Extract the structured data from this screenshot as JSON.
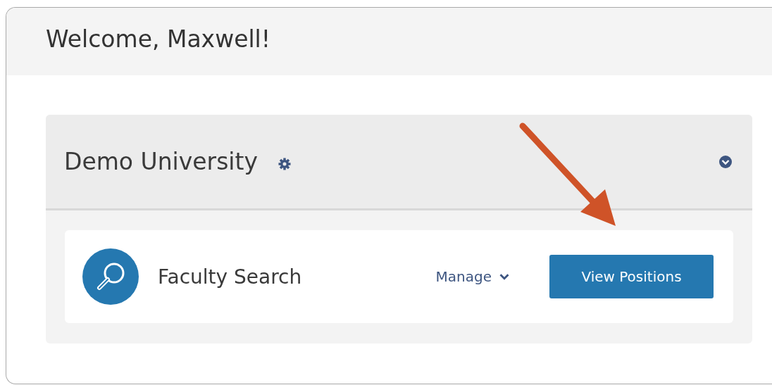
{
  "page": {
    "title": "Welcome, Maxwell!"
  },
  "organization": {
    "name": "Demo University",
    "expanded": true
  },
  "products": [
    {
      "name": "Faculty Search",
      "menu": "Manage",
      "action": "View Positions"
    }
  ]
}
